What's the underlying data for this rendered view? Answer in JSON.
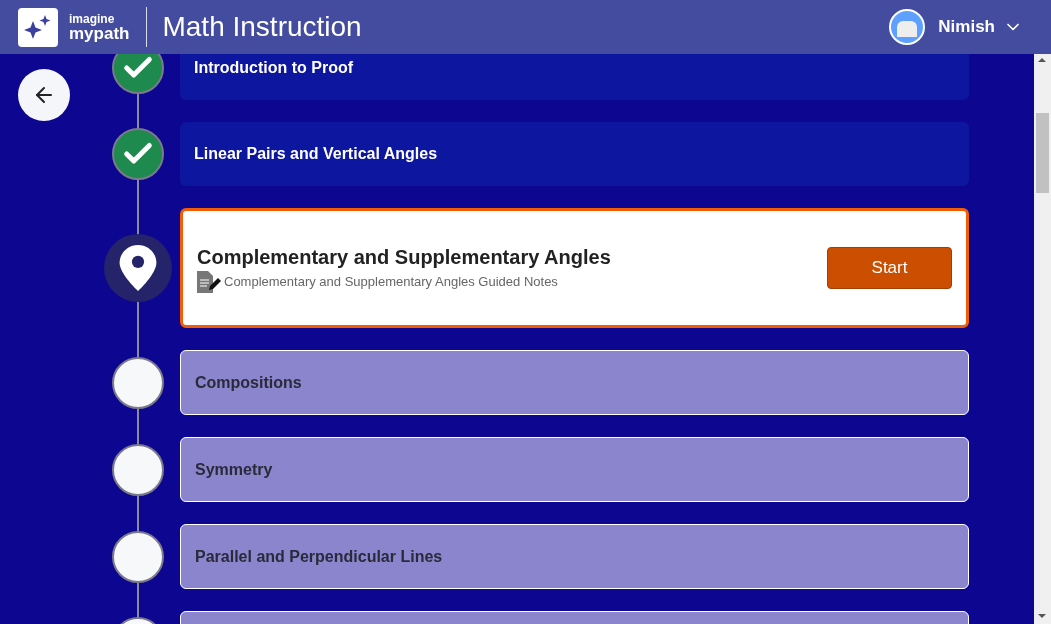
{
  "header": {
    "logo": {
      "line1": "imagine",
      "line2": "mypath"
    },
    "title": "Math Instruction",
    "user": {
      "name": "Nimish"
    }
  },
  "lessons": [
    {
      "kind": "completed",
      "title": "Introduction to Proof"
    },
    {
      "kind": "completed",
      "title": "Linear Pairs and Vertical Angles"
    },
    {
      "kind": "current",
      "title": "Complementary and Supplementary Angles",
      "resource": "Complementary and Supplementary Angles Guided Notes",
      "button": "Start"
    },
    {
      "kind": "locked",
      "title": "Compositions"
    },
    {
      "kind": "locked",
      "title": "Symmetry"
    },
    {
      "kind": "locked",
      "title": "Parallel and Perpendicular Lines"
    }
  ]
}
